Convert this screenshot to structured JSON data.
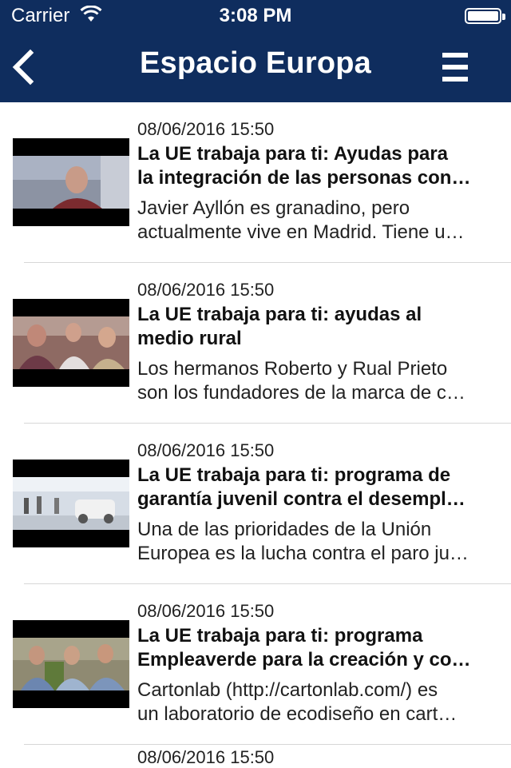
{
  "status_bar": {
    "carrier": "Carrier",
    "time": "3:08 PM"
  },
  "nav": {
    "title": "Espacio Europa",
    "back_icon": "chevron-left-icon",
    "menu_icon": "hamburger-menu-icon",
    "background": "#0f2d5e"
  },
  "items": [
    {
      "date": "08/06/2016 15:50",
      "title_line1": "La UE trabaja para ti:  Ayudas para",
      "title_line2": "la integración de las personas con…",
      "desc_line1": "Javier Ayllón es granadino, pero",
      "desc_line2": "actualmente vive en Madrid. Tiene u…"
    },
    {
      "date": "08/06/2016 15:50",
      "title_line1": "La UE trabaja para ti: ayudas al",
      "title_line2": "medio rural",
      "desc_line1": "Los hermanos Roberto y Rual Prieto",
      "desc_line2": "son los fundadores de la marca de c…"
    },
    {
      "date": "08/06/2016 15:50",
      "title_line1": "La UE trabaja para ti: programa de",
      "title_line2": "garantía juvenil contra el desempl…",
      "desc_line1": "Una de las prioridades de la Unión",
      "desc_line2": "Europea es la lucha contra el paro ju…"
    },
    {
      "date": "08/06/2016 15:50",
      "title_line1": "La UE trabaja para ti: programa",
      "title_line2": "Empleaverde para la creación y co…",
      "desc_line1": "Cartonlab (http://cartonlab.com/) es",
      "desc_line2": "un laboratorio de ecodiseño en cart…"
    }
  ],
  "partial_date": "08/06/2016 15:50"
}
